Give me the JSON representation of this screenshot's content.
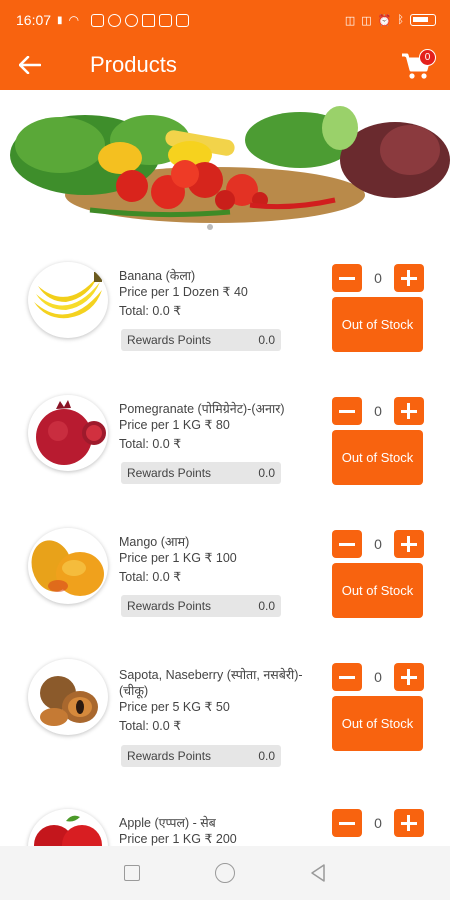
{
  "status_bar": {
    "time": "16:07"
  },
  "app_bar": {
    "title": "Products",
    "cart_count": "0"
  },
  "products": [
    {
      "name": "Banana (केला)",
      "price": "Price per 1 Dozen ₹ 40",
      "total": "Total: 0.0 ₹",
      "rewards_label": "Rewards Points",
      "rewards_value": "0.0",
      "qty": "0",
      "stock_button": "Out of Stock"
    },
    {
      "name": "Pomegranate (पोमिग्रेनेट)-(अनार)",
      "price": "Price per 1 KG ₹ 80",
      "total": "Total: 0.0 ₹",
      "rewards_label": "Rewards Points",
      "rewards_value": "0.0",
      "qty": "0",
      "stock_button": "Out of Stock"
    },
    {
      "name": "Mango (आम)",
      "price": "Price per 1 KG ₹ 100",
      "total": "Total: 0.0 ₹",
      "rewards_label": "Rewards Points",
      "rewards_value": "0.0",
      "qty": "0",
      "stock_button": "Out of Stock"
    },
    {
      "name": "Sapota, Naseberry (स्पोता, नसबेरी)-(चीकू)",
      "price": "Price per 5 KG ₹ 50",
      "total": "Total: 0.0 ₹",
      "rewards_label": "Rewards Points",
      "rewards_value": "0.0",
      "qty": "0",
      "stock_button": "Out of Stock"
    },
    {
      "name": "Apple (एप्पल) - सेब",
      "price": "Price per 1 KG ₹ 200",
      "qty": "0"
    }
  ],
  "colors": {
    "accent": "#f8630f",
    "badge": "#e4201c",
    "rewards_bg": "#e6e6e6"
  },
  "icons": {
    "back": "arrow-left-icon",
    "cart": "shopping-cart-icon",
    "minus": "minus-icon",
    "plus": "plus-icon"
  }
}
